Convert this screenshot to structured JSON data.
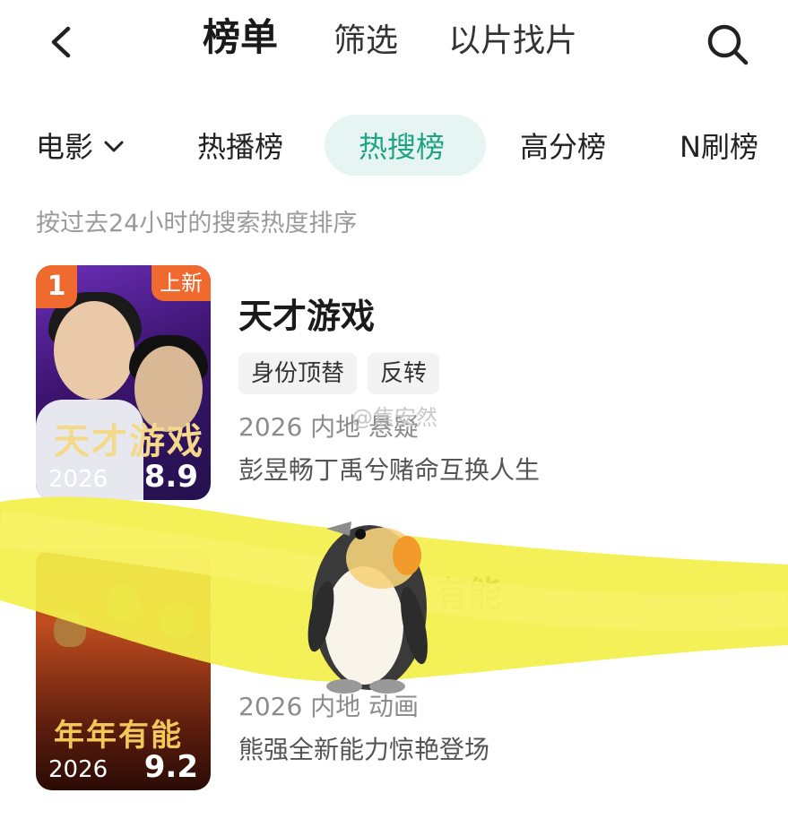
{
  "topbar": {
    "tabs": [
      "榜单",
      "筛选",
      "以片找片"
    ]
  },
  "categories": {
    "type_label": "电影",
    "tabs": [
      "热播榜",
      "热搜榜",
      "高分榜",
      "N刷榜"
    ],
    "active": "热搜榜"
  },
  "description": "按过去24小时的搜索热度排序",
  "watermark": "@焦安然",
  "items": [
    {
      "rank": "1",
      "badge": "上新",
      "title": "天才游戏",
      "tags": [
        "身份顶替",
        "反转"
      ],
      "meta": "2026 内地 悬疑",
      "intro": "彭昱畅丁禹兮赌命互换人生",
      "poster_year": "2026",
      "poster_score": "8.9",
      "poster_art": "天才游戏"
    },
    {
      "title": "有能",
      "meta": "2026 内地 动画",
      "intro": "熊强全新能力惊艳登场",
      "poster_year": "2026",
      "poster_score": "9.2",
      "poster_art": "年年有能"
    }
  ],
  "colors": {
    "accent": "#1ea384",
    "accent_bg": "#e6f5f1",
    "rank_badge": "#f06a2f",
    "scribble": "#f3f04a"
  }
}
